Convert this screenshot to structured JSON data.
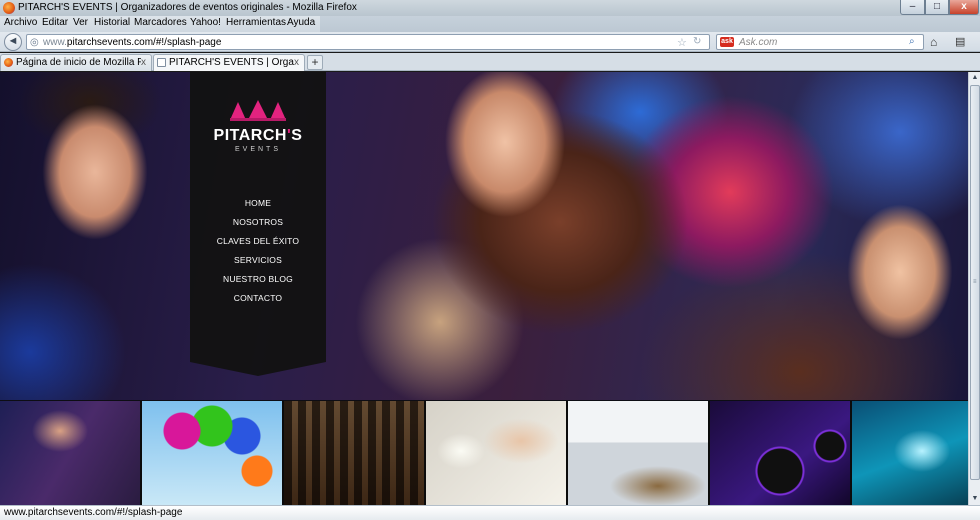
{
  "window": {
    "title": "PITARCH'S EVENTS | Organizadores de eventos originales - Mozilla Firefox",
    "minimize_label": "–",
    "maximize_label": "□",
    "close_label": "x"
  },
  "menubar": {
    "items": [
      "Archivo",
      "Editar",
      "Ver",
      "Historial",
      "Marcadores",
      "Yahoo!",
      "Herramientas",
      "Ayuda"
    ]
  },
  "navbar": {
    "back_label": "◄",
    "url_prefix": "www.",
    "url": "pitarchsevents.com/#!/splash-page",
    "search_placeholder": "Ask.com",
    "search_engine_badge": "ask",
    "icons": [
      "back-arrow-icon",
      "globe-icon",
      "star-icon",
      "search-icon",
      "home-icon",
      "bookmarks-icon"
    ]
  },
  "tabs": [
    {
      "label": "Página de inicio de Mozilla Fi...",
      "active": false,
      "close": "x"
    },
    {
      "label": "PITARCH'S EVENTS | Organiz...",
      "active": true,
      "close": "x"
    }
  ],
  "newtab_label": "+",
  "site": {
    "logo_text": "PITARCH",
    "logo_apos": "'",
    "logo_s": "S",
    "logo_sub": "EVENTS",
    "nav": [
      "HOME",
      "NOSOTROS",
      "CLAVES DEL ÉXITO",
      "SERVICIOS",
      "NUESTRO BLOG",
      "CONTACTO"
    ],
    "thumbnails": [
      "party-crowd",
      "balloons-clown",
      "fashion-runway",
      "wedding-hands",
      "catering-buffet",
      "dj-turntables",
      "concert-lights"
    ],
    "colors": {
      "brand_pink": "#e3237f",
      "panel": "#121212"
    }
  },
  "statusbar": {
    "text": "www.pitarchsevents.com/#!/splash-page"
  }
}
